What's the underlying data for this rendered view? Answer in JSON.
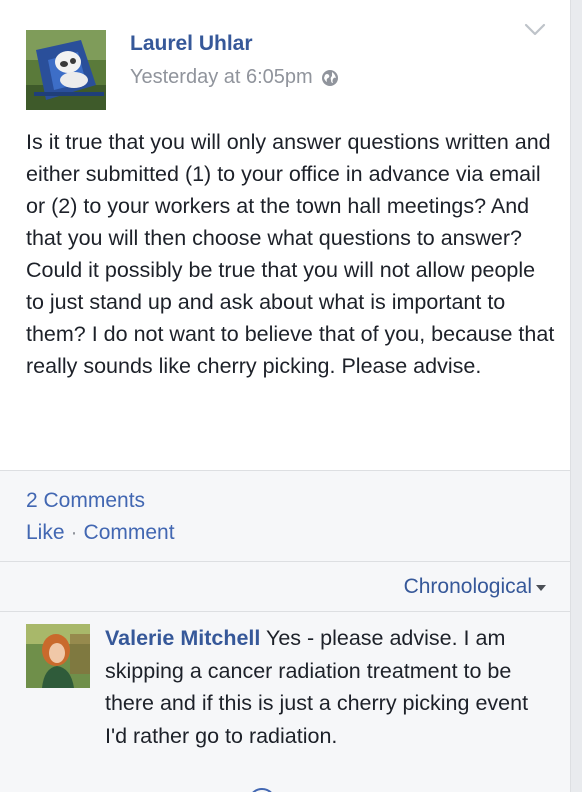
{
  "post": {
    "author": "Laurel Uhlar",
    "timestamp": "Yesterday at 6:05pm",
    "privacy_icon": "globe-icon",
    "body": "Is it true that you will only answer questions written and either submitted (1) to your office in advance via email or (2) to your workers at the town hall meetings? And that you will then choose what questions to answer? Could it possibly be true that you will not allow people to just stand up and ask about what is important to them? I do not want to believe that of you, because that really sounds like cherry picking. Please advise."
  },
  "footer": {
    "comments_count": "2 Comments",
    "like_label": "Like",
    "separator": "·",
    "comment_label": "Comment"
  },
  "sort": {
    "label": "Chronological"
  },
  "comment": {
    "author": "Valerie Mitchell",
    "text": "Yes - please advise. I am skipping a cancer radiation treatment to be there and if this is just a cherry picking event I'd rather go to radiation."
  },
  "colors": {
    "link_blue": "#365899",
    "action_blue": "#4267b2",
    "meta_gray": "#90949c",
    "text": "#1d2129",
    "footer_bg": "#f6f7f9"
  }
}
